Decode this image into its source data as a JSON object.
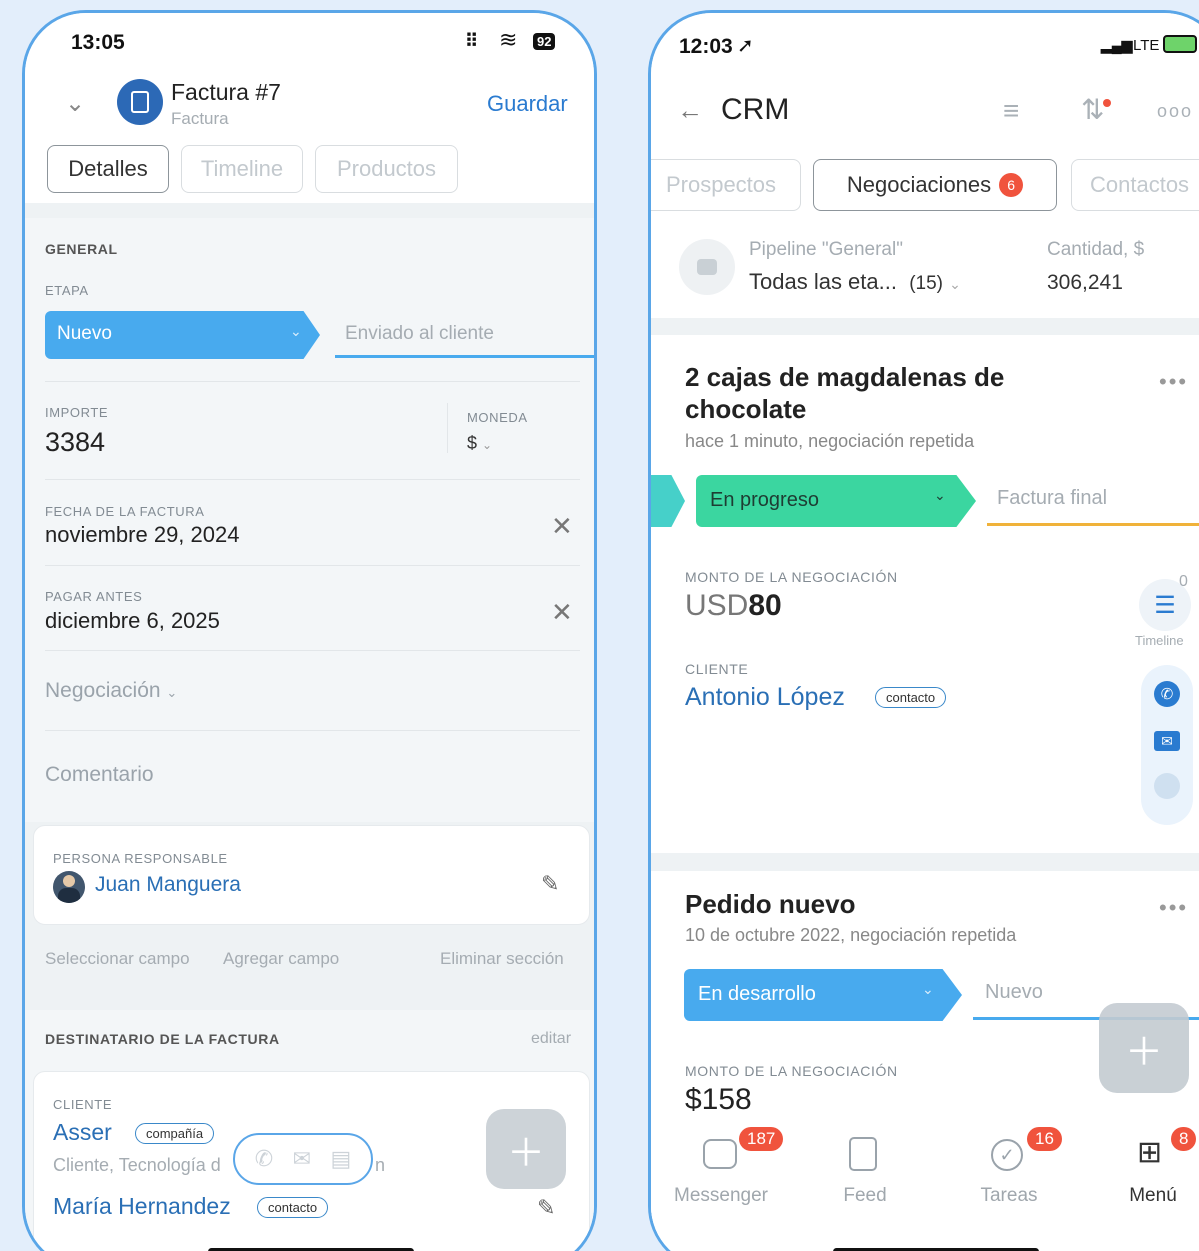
{
  "left": {
    "status": {
      "time": "13:05",
      "battery": "92"
    },
    "header": {
      "title": "Factura #7",
      "subtitle": "Factura",
      "save": "Guardar"
    },
    "tabs": [
      "Detalles",
      "Timeline",
      "Productos"
    ],
    "general": {
      "section": "GENERAL",
      "stage_label": "ETAPA",
      "stage_current": "Nuevo",
      "stage_next": "Enviado al cliente",
      "amount_label": "IMPORTE",
      "amount": "3384",
      "currency_label": "MONEDA",
      "currency": "$",
      "invoice_date_label": "FECHA DE LA FACTURA",
      "invoice_date": "noviembre 29, 2024",
      "pay_before_label": "PAGAR ANTES",
      "pay_before": "diciembre 6, 2025",
      "deal_placeholder": "Negociación",
      "comment_placeholder": "Comentario",
      "responsible_label": "PERSONA RESPONSABLE",
      "responsible": "Juan Manguera",
      "select_field": "Seleccionar campo",
      "add_field": "Agregar campo",
      "delete_section": "Eliminar sección"
    },
    "recipient": {
      "section": "DESTINATARIO DE LA FACTURA",
      "edit": "editar",
      "client_label": "CLIENTE",
      "client": "Asser",
      "client_tag": "compañía",
      "client_desc": "Cliente, Tecnología d",
      "client_desc_tail": "n",
      "contact": "María Hernandez",
      "contact_tag": "contacto"
    }
  },
  "right": {
    "status": {
      "time": "12:03",
      "network": "LTE"
    },
    "header": {
      "title": "CRM"
    },
    "tabs": {
      "left": "Prospectos",
      "active": "Negociaciones",
      "active_badge": "6",
      "right": "Contactos"
    },
    "pipeline": {
      "label": "Pipeline \"General\"",
      "stages": "Todas las eta...",
      "count": "(15)",
      "amount_label": "Cantidad, $",
      "amount": "306,241"
    },
    "deal1": {
      "title": "2 cajas de magdalenas de chocolate",
      "meta": "hace 1 minuto, negociación repetida",
      "stage_current": "En progreso",
      "stage_next": "Factura final",
      "amount_label": "MONTO DE LA NEGOCIACIÓN",
      "amount_prefix": "USD",
      "amount_value": "80",
      "client_label": "CLIENTE",
      "client": "Antonio López",
      "client_tag": "contacto",
      "timeline_label": "Timeline"
    },
    "deal2": {
      "title": "Pedido nuevo",
      "meta": "10 de octubre 2022, negociación repetida",
      "stage_current": "En desarrollo",
      "stage_next": "Nuevo",
      "amount_label": "MONTO DE LA NEGOCIACIÓN",
      "amount": "$158"
    },
    "nav": [
      {
        "label": "Messenger",
        "badge": "187",
        "icon": "chat-icon"
      },
      {
        "label": "Feed",
        "badge": "",
        "icon": "feed-icon"
      },
      {
        "label": "Tareas",
        "badge": "16",
        "icon": "check-icon"
      },
      {
        "label": "Menú",
        "badge": "8",
        "icon": "menu-grid-icon"
      }
    ]
  },
  "colors": {
    "accent": "#3a9ef0",
    "green": "#3bd6a0",
    "badge": "#f0533d",
    "frame": "#5aa6e8"
  }
}
